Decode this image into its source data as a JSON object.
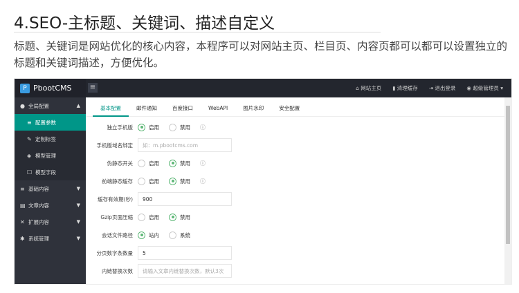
{
  "heading": "4.SEO-主标题、关键词、描述自定义",
  "paragraph": "标题、关键词是网站优化的核心内容，本程序可以对网站主页、栏目页、内容页都可以都可以设置独立的标题和关键词描述，方便优化。",
  "app": {
    "logo": "PbootCMS",
    "topnav": [
      "网站主页",
      "清理缓存",
      "退出登录",
      "超级管理员"
    ],
    "sidebar": [
      {
        "label": "全局配置",
        "icon": "globe-icon",
        "arrow": "▲"
      },
      {
        "label": "配置参数",
        "icon": "sliders-icon",
        "active": true,
        "sub": true
      },
      {
        "label": "定制标签",
        "icon": "wrench-icon",
        "sub": true
      },
      {
        "label": "模型管理",
        "icon": "cube-icon",
        "sub": true
      },
      {
        "label": "模型字段",
        "icon": "edit-icon",
        "sub": true
      },
      {
        "label": "基础内容",
        "icon": "sliders-icon",
        "arrow": "▼"
      },
      {
        "label": "文章内容",
        "icon": "file-icon",
        "arrow": "▼"
      },
      {
        "label": "扩展内容",
        "icon": "expand-icon",
        "arrow": "▼"
      },
      {
        "label": "系统管理",
        "icon": "gear-icon",
        "arrow": "▼"
      }
    ],
    "tabs": [
      "基本配置",
      "邮件通知",
      "百度接口",
      "WebAPI",
      "图片水印",
      "安全配置"
    ],
    "form": {
      "mobile": {
        "label": "独立手机版",
        "opt1": "启用",
        "opt2": "禁用"
      },
      "domain": {
        "label": "手机版域名绑定",
        "placeholder": "如：m.pbootcms.com"
      },
      "rewrite": {
        "label": "伪静态开关",
        "opt1": "启用",
        "opt2": "禁用"
      },
      "cache": {
        "label": "前端静态缓存",
        "opt1": "启用",
        "opt2": "禁用"
      },
      "cachetime": {
        "label": "缓存有效期(秒)",
        "value": "900"
      },
      "gzip": {
        "label": "Gzip页面压缩",
        "opt1": "启用",
        "opt2": "禁用"
      },
      "session": {
        "label": "会话文件路径",
        "opt1": "站内",
        "opt2": "系统"
      },
      "pagenum": {
        "label": "分页数字条数量",
        "value": "5"
      },
      "link": {
        "label": "内链替换次数",
        "placeholder": "请输入文章内链替换次数，默认3次"
      }
    }
  }
}
